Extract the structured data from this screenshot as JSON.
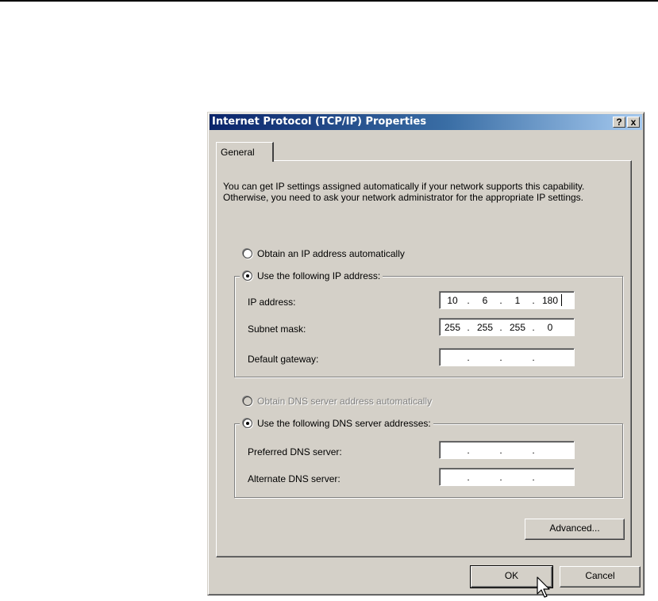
{
  "dialog": {
    "title": "Internet Protocol (TCP/IP) Properties",
    "help_button": "?",
    "close_button": "x"
  },
  "tabs": [
    {
      "label": "General"
    }
  ],
  "intro_text": "You can get IP settings assigned automatically if your network supports this capability. Otherwise, you need to ask your network administrator for the appropriate IP settings.",
  "ip_section": {
    "auto_option": "Obtain an IP address automatically",
    "manual_option": "Use the following IP address:",
    "selected": "manual",
    "fields": [
      {
        "label": "IP address:",
        "octets": [
          "10",
          "6",
          "1",
          "180"
        ]
      },
      {
        "label": "Subnet mask:",
        "octets": [
          "255",
          "255",
          "255",
          "0"
        ]
      },
      {
        "label": "Default gateway:",
        "octets": [
          "",
          "",
          "",
          ""
        ]
      }
    ]
  },
  "dns_section": {
    "auto_option": "Obtain DNS server address automatically",
    "auto_disabled": true,
    "manual_option": "Use the following DNS server addresses:",
    "selected": "manual",
    "fields": [
      {
        "label": "Preferred DNS server:",
        "octets": [
          "",
          "",
          "",
          ""
        ]
      },
      {
        "label": "Alternate DNS server:",
        "octets": [
          "",
          "",
          "",
          ""
        ]
      }
    ]
  },
  "buttons": {
    "advanced": "Advanced...",
    "ok": "OK",
    "cancel": "Cancel"
  },
  "icons": [
    "question-mark-icon",
    "close-icon",
    "mouse-pointer-icon"
  ]
}
